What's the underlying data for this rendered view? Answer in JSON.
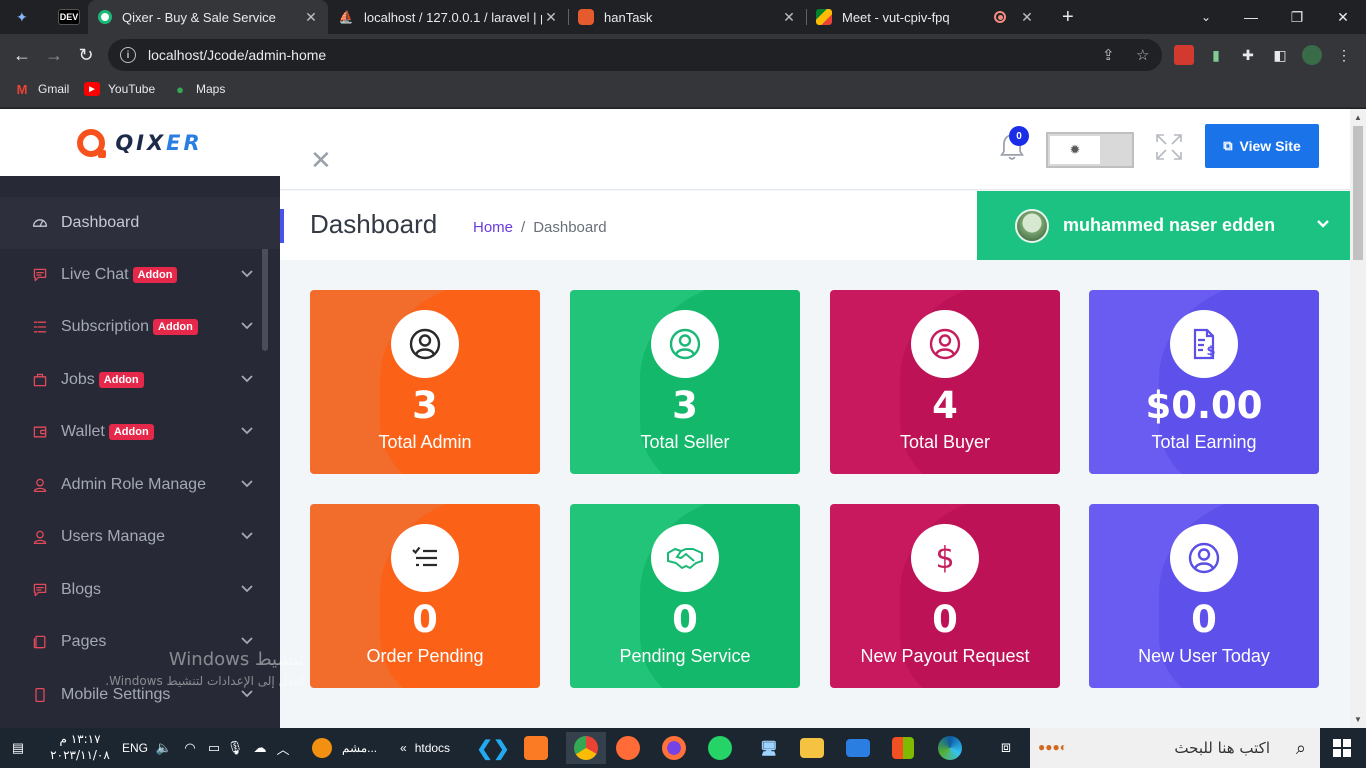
{
  "browser": {
    "tabs": [
      {
        "title": "Qixer - Buy & Sale Service",
        "active": true
      },
      {
        "title": "localhost / 127.0.0.1 / laravel | ph",
        "active": false
      },
      {
        "title": "hanTask",
        "active": false
      },
      {
        "title": "Meet - vut-cpiv-fpq",
        "active": false
      }
    ],
    "dev_badge": "DEV",
    "url": "localhost/Jcode/admin-home",
    "bookmarks": [
      "Gmail",
      "YouTube",
      "Maps"
    ]
  },
  "brand": {
    "logo_main": "QIX",
    "logo_accent": "ER",
    "accent_color": "#f7521d"
  },
  "sidebar": {
    "addon_label": "Addon",
    "items": [
      {
        "label": "Dashboard",
        "icon": "dashboard-gauge-icon",
        "addon": false,
        "chevron": false,
        "active": true
      },
      {
        "label": "Live Chat",
        "icon": "chat-icon",
        "addon": true,
        "chevron": true,
        "active": false
      },
      {
        "label": "Subscription",
        "icon": "list-icon",
        "addon": true,
        "chevron": true,
        "active": false
      },
      {
        "label": "Jobs",
        "icon": "briefcase-icon",
        "addon": true,
        "chevron": true,
        "active": false
      },
      {
        "label": "Wallet",
        "icon": "wallet-icon",
        "addon": true,
        "chevron": true,
        "active": false
      },
      {
        "label": "Admin Role Manage",
        "icon": "user-icon",
        "addon": false,
        "chevron": true,
        "active": false
      },
      {
        "label": "Users Manage",
        "icon": "user-icon",
        "addon": false,
        "chevron": true,
        "active": false
      },
      {
        "label": "Blogs",
        "icon": "chat-icon",
        "addon": false,
        "chevron": true,
        "active": false
      },
      {
        "label": "Pages",
        "icon": "pages-icon",
        "addon": false,
        "chevron": true,
        "active": false
      },
      {
        "label": "Mobile Settings",
        "icon": "mobile-icon",
        "addon": false,
        "chevron": true,
        "active": false
      }
    ]
  },
  "topbar": {
    "notification_count": "0",
    "view_site_label": "View Site"
  },
  "header": {
    "title": "Dashboard",
    "breadcrumb_home": "Home",
    "breadcrumb_sep": "/",
    "breadcrumb_current": "Dashboard",
    "user_name": "muhammed naser edden"
  },
  "cards": [
    {
      "value": "3",
      "label": "Total Admin",
      "icon": "user-circle-icon",
      "color": "#f26c2c",
      "blob": "#fb6218",
      "icon_color": "#2a2a2a"
    },
    {
      "value": "3",
      "label": "Total Seller",
      "icon": "user-circle-icon",
      "color": "#22c47a",
      "blob": "#13b86a",
      "icon_color": "#1cb878"
    },
    {
      "value": "4",
      "label": "Total Buyer",
      "icon": "user-circle-icon",
      "color": "#c8195f",
      "blob": "#bd1256",
      "icon_color": "#c61d5e"
    },
    {
      "value": "$0.00",
      "label": "Total Earning",
      "icon": "invoice-dollar-icon",
      "color": "#6a5cf0",
      "blob": "#5e50ea",
      "icon_color": "#5b4fe6"
    },
    {
      "value": "0",
      "label": "Order Pending",
      "icon": "checklist-icon",
      "color": "#f26c2c",
      "blob": "#fb6218",
      "icon_color": "#2a2a2a"
    },
    {
      "value": "0",
      "label": "Pending Service",
      "icon": "handshake-icon",
      "color": "#22c47a",
      "blob": "#13b86a",
      "icon_color": "#1cb878"
    },
    {
      "value": "0",
      "label": "New Payout Request",
      "icon": "dollar-icon",
      "color": "#c8195f",
      "blob": "#bd1256",
      "icon_color": "#c61d5e"
    },
    {
      "value": "0",
      "label": "New User Today",
      "icon": "user-circle-icon",
      "color": "#6a5cf0",
      "blob": "#5e50ea",
      "icon_color": "#5b4fe6"
    }
  ],
  "windows_watermark": {
    "line1": "تنشيط Windows",
    "line2": "انتقل إلى الإعدادات لتنشيط Windows."
  },
  "taskbar": {
    "time": "١٣:١٧ م",
    "date": "٢٠٢٣/١١/٠٨",
    "lang": "ENG",
    "app_mshm": "مشم...",
    "app_htdocs": "htdocs",
    "search_placeholder": "اكتب هنا للبحث"
  }
}
